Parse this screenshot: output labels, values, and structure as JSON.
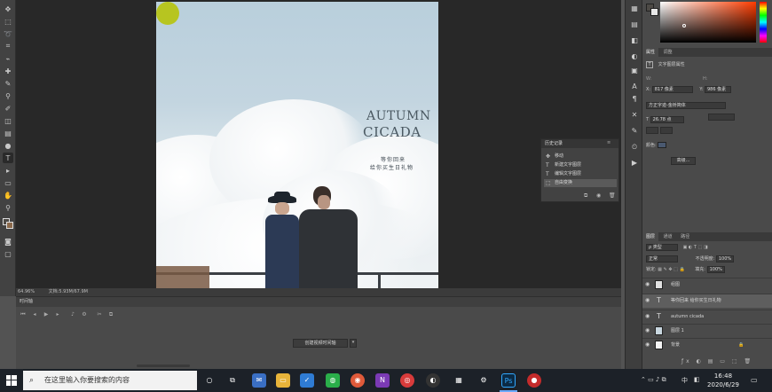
{
  "status": {
    "zoom": "64.96%",
    "doc_info": "文档:5.93M/67.9M"
  },
  "timeline": {
    "title": "时间轴",
    "create_button": "创建视频时间轴"
  },
  "history": {
    "title": "历史记录",
    "items": [
      {
        "icon": "move-icon",
        "label": "移动"
      },
      {
        "icon": "text-icon",
        "label": "新建文字图层"
      },
      {
        "icon": "text-icon",
        "label": "编辑文字图层"
      },
      {
        "icon": "transform-icon",
        "label": "自由变换"
      }
    ]
  },
  "poster": {
    "title_line1": "AUTUMN",
    "title_line2": "CICADA",
    "sub_line1": "等你回来",
    "sub_line2": "给你买生日礼物",
    "sun_color": "#b7c520"
  },
  "properties": {
    "tabs": [
      "属性",
      "调整"
    ],
    "header": "文字图层属性",
    "w_label": "W:",
    "w_value": "817 像素",
    "h_label": "H:",
    "h_value": "986 像素",
    "x_label": "X:",
    "x_value": "",
    "y_label": "Y:",
    "y_value": "",
    "font": "方正字迹-金桥简体",
    "size": "26.78 点",
    "color_label": "颜色:",
    "advanced_button": "高级..."
  },
  "layers": {
    "tabs": [
      "图层",
      "通道",
      "路径"
    ],
    "filter": "ρ 类型",
    "blend_mode": "正常",
    "opacity_label": "不透明度:",
    "opacity_value": "100%",
    "lock_label": "锁定:",
    "fill_label": "填充:",
    "fill_value": "100%",
    "items": [
      {
        "name": "组图",
        "kind": "image",
        "selected": false
      },
      {
        "name": "等你回来 给你买生日礼物",
        "kind": "text",
        "selected": true
      },
      {
        "name": "autumn cicada",
        "kind": "text",
        "selected": false
      },
      {
        "name": "图层 1",
        "kind": "image",
        "selected": false
      },
      {
        "name": "背景",
        "kind": "image",
        "selected": false
      }
    ]
  },
  "taskbar": {
    "search_placeholder": "在这里输入你要搜索的内容",
    "time": "16:48",
    "date": "2020/6/29",
    "ime": "中"
  }
}
